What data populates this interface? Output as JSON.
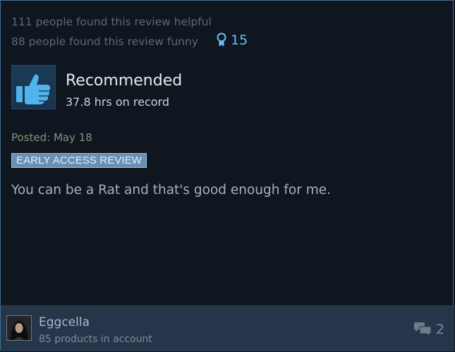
{
  "review": {
    "helpful_text": "111 people found this review helpful",
    "funny_text": "88 people found this review funny",
    "award_count": "15",
    "recommendation": "Recommended",
    "hours_on_record": "37.8 hrs on record",
    "posted": "Posted: May 18",
    "early_access_badge": "EARLY ACCESS REVIEW",
    "body": "You can be a Rat and that's good enough for me."
  },
  "author": {
    "name": "Eggcella",
    "products": "85 products in account",
    "comment_count": "2"
  },
  "colors": {
    "accent": "#66c0f4",
    "thumb_icon": "#4fb3ec",
    "card_background": "#0f1620",
    "footer_background": "#26364a"
  },
  "icons": {
    "award": "award-ribbon-icon",
    "recommendation": "thumbs-up-icon",
    "comments": "speech-bubbles-icon"
  }
}
